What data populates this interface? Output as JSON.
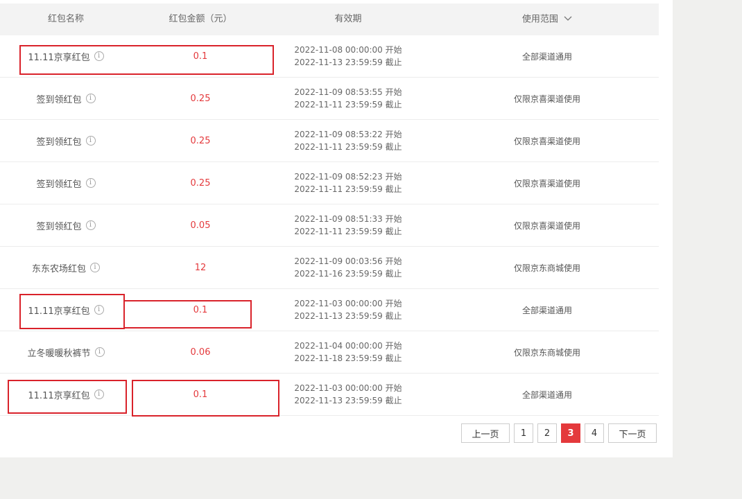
{
  "header": {
    "col_name": "红包名称",
    "col_amount": "红包金额（元）",
    "col_validity": "有效期",
    "col_scope": "使用范围"
  },
  "info_glyph": "i",
  "rows": [
    {
      "name": "11.11京享红包",
      "amount": "0.1",
      "start": "2022-11-08 00:00:00 开始",
      "end": "2022-11-13 23:59:59 截止",
      "scope": "全部渠道通用"
    },
    {
      "name": "签到领红包",
      "amount": "0.25",
      "start": "2022-11-09 08:53:55 开始",
      "end": "2022-11-11 23:59:59 截止",
      "scope": "仅限京喜渠道使用"
    },
    {
      "name": "签到领红包",
      "amount": "0.25",
      "start": "2022-11-09 08:53:22 开始",
      "end": "2022-11-11 23:59:59 截止",
      "scope": "仅限京喜渠道使用"
    },
    {
      "name": "签到领红包",
      "amount": "0.25",
      "start": "2022-11-09 08:52:23 开始",
      "end": "2022-11-11 23:59:59 截止",
      "scope": "仅限京喜渠道使用"
    },
    {
      "name": "签到领红包",
      "amount": "0.05",
      "start": "2022-11-09 08:51:33 开始",
      "end": "2022-11-11 23:59:59 截止",
      "scope": "仅限京喜渠道使用"
    },
    {
      "name": "东东农场红包",
      "amount": "12",
      "start": "2022-11-09 00:03:56 开始",
      "end": "2022-11-16 23:59:59 截止",
      "scope": "仅限京东商城使用"
    },
    {
      "name": "11.11京享红包",
      "amount": "0.1",
      "start": "2022-11-03 00:00:00 开始",
      "end": "2022-11-13 23:59:59 截止",
      "scope": "全部渠道通用"
    },
    {
      "name": "立冬暖暖秋裤节",
      "amount": "0.06",
      "start": "2022-11-04 00:00:00 开始",
      "end": "2022-11-18 23:59:59 截止",
      "scope": "仅限京东商城使用"
    },
    {
      "name": "11.11京享红包",
      "amount": "0.1",
      "start": "2022-11-03 00:00:00 开始",
      "end": "2022-11-13 23:59:59 截止",
      "scope": "全部渠道通用"
    }
  ],
  "pagination": {
    "prev": "上一页",
    "pages": [
      "1",
      "2",
      "3",
      "4"
    ],
    "current": "3",
    "next": "下一页"
  },
  "colors": {
    "accent": "#e4393c",
    "highlight_box": "#d9222a"
  }
}
